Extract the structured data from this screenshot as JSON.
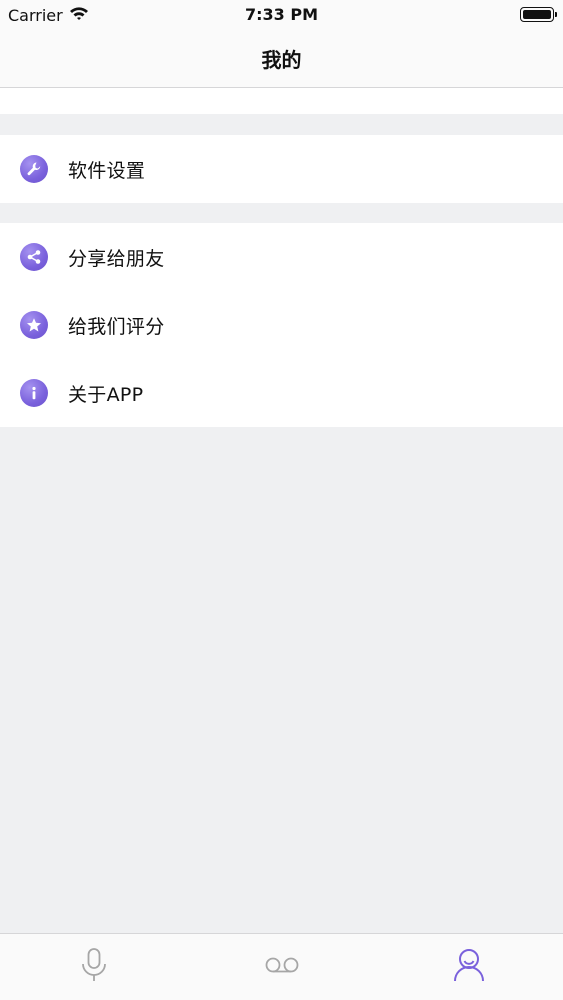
{
  "status_bar": {
    "carrier": "Carrier",
    "time": "7:33 PM"
  },
  "nav": {
    "title": "我的"
  },
  "settings_group": [
    {
      "label": "软件设置",
      "icon": "wrench-icon"
    }
  ],
  "social_group": [
    {
      "label": "分享给朋友",
      "icon": "share-icon"
    },
    {
      "label": "给我们评分",
      "icon": "star-icon"
    },
    {
      "label": "关于APP",
      "icon": "info-icon"
    }
  ],
  "tab_bar": {
    "tabs": [
      {
        "icon": "microphone-icon",
        "active": false
      },
      {
        "icon": "voicemail-icon",
        "active": false
      },
      {
        "icon": "person-icon",
        "active": true
      }
    ]
  },
  "colors": {
    "accent": "#7a61dc",
    "inactive_tab": "#a6a6a6",
    "background": "#eff0f2"
  }
}
